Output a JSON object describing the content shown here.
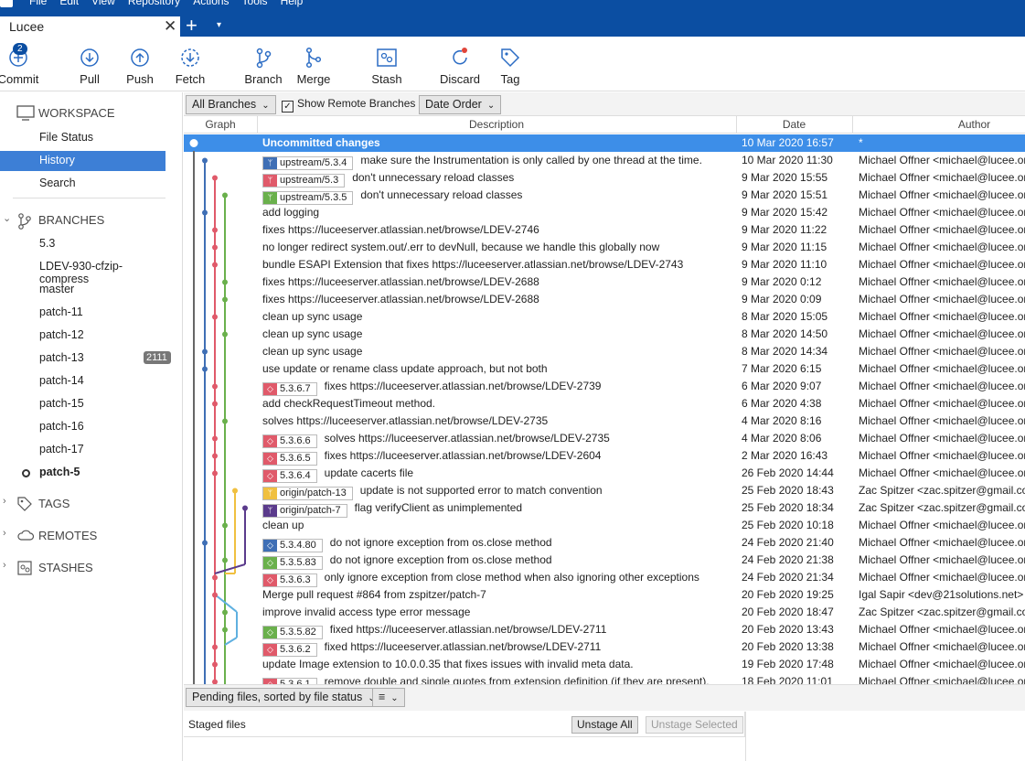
{
  "menu": {
    "items": [
      "File",
      "Edit",
      "View",
      "Repository",
      "Actions",
      "Tools",
      "Help"
    ]
  },
  "tab": {
    "title": "Lucee",
    "close": "✕",
    "new_tab": "+",
    "dropdown": "▾"
  },
  "toolbar": {
    "commit_badge": "2",
    "buttons": [
      {
        "label": "Commit",
        "icon": "commit-icon"
      },
      {
        "label": "Pull",
        "icon": "pull-icon"
      },
      {
        "label": "Push",
        "icon": "push-icon"
      },
      {
        "label": "Fetch",
        "icon": "fetch-icon"
      },
      {
        "label": "Branch",
        "icon": "branch-icon"
      },
      {
        "label": "Merge",
        "icon": "merge-icon"
      },
      {
        "label": "Stash",
        "icon": "stash-icon"
      },
      {
        "label": "Discard",
        "icon": "discard-icon"
      },
      {
        "label": "Tag",
        "icon": "tag-icon"
      }
    ]
  },
  "sidebar": {
    "workspace": {
      "title": "WORKSPACE",
      "items": [
        "File Status",
        "History",
        "Search"
      ],
      "active": "History"
    },
    "branches": {
      "title": "BRANCHES",
      "items": [
        "5.3",
        "LDEV-930-cfzip-compress",
        "master",
        "patch-11",
        "patch-12",
        "patch-13",
        "patch-14",
        "patch-15",
        "patch-16",
        "patch-17",
        "patch-5"
      ],
      "badge_patch13": "2111",
      "current": "patch-5"
    },
    "tags": {
      "title": "TAGS"
    },
    "remotes": {
      "title": "REMOTES"
    },
    "stashes": {
      "title": "STASHES"
    }
  },
  "filterbar": {
    "branches_select": "All Branches",
    "show_remote_label": "Show Remote Branches",
    "show_remote_checked": true,
    "order_select": "Date Order"
  },
  "columns": {
    "graph": "Graph",
    "description": "Description",
    "date": "Date",
    "author": "Author"
  },
  "colors": {
    "accent": "#0b4ea2",
    "selection": "#3d8ee8",
    "red": "#e05a6a",
    "green": "#6ab04c",
    "blue": "#3f6fb5",
    "yellow": "#f0c040",
    "purple": "#5b3b8c",
    "cyan": "#5fb0e0"
  },
  "commits": [
    {
      "desc": "Uncommitted changes",
      "date": "10 Mar 2020 16:57",
      "author": "*",
      "selected": true
    },
    {
      "tag": "upstream/5.3.4",
      "tag_kind": "branch",
      "tag_color": "#3f6fb5",
      "desc": "make sure the Instrumentation is only called by one thread at the time.",
      "date": "10 Mar 2020 11:30",
      "author": "Michael Offner <michael@lucee.org>"
    },
    {
      "tag": "upstream/5.3",
      "tag_kind": "branch",
      "tag_color": "#e05a6a",
      "desc": "don't unnecessary reload classes",
      "date": "9 Mar 2020 15:55",
      "author": "Michael Offner <michael@lucee.org>"
    },
    {
      "tag": "upstream/5.3.5",
      "tag_kind": "branch",
      "tag_color": "#6ab04c",
      "desc": "don't unnecessary reload classes",
      "date": "9 Mar 2020 15:51",
      "author": "Michael Offner <michael@lucee.org>"
    },
    {
      "desc": "add logging",
      "date": "9 Mar 2020 15:42",
      "author": "Michael Offner <michael@lucee.org>"
    },
    {
      "desc": "fixes https://luceeserver.atlassian.net/browse/LDEV-2746",
      "date": "9 Mar 2020 11:22",
      "author": "Michael Offner <michael@lucee.org>"
    },
    {
      "desc": "no longer redirect system.out/.err to devNull, because we handle this globally now",
      "date": "9 Mar 2020 11:15",
      "author": "Michael Offner <michael@lucee.org>"
    },
    {
      "desc": "bundle ESAPI Extension that fixes https://luceeserver.atlassian.net/browse/LDEV-2743",
      "date": "9 Mar 2020 11:10",
      "author": "Michael Offner <michael@lucee.org>"
    },
    {
      "desc": "fixes https://luceeserver.atlassian.net/browse/LDEV-2688",
      "date": "9 Mar 2020 0:12",
      "author": "Michael Offner <michael@lucee.org>"
    },
    {
      "desc": "fixes https://luceeserver.atlassian.net/browse/LDEV-2688",
      "date": "9 Mar 2020 0:09",
      "author": "Michael Offner <michael@lucee.org>"
    },
    {
      "desc": "clean up sync usage",
      "date": "8 Mar 2020 15:05",
      "author": "Michael Offner <michael@lucee.org>"
    },
    {
      "desc": "clean up sync usage",
      "date": "8 Mar 2020 14:50",
      "author": "Michael Offner <michael@lucee.org>"
    },
    {
      "desc": "clean up sync usage",
      "date": "8 Mar 2020 14:34",
      "author": "Michael Offner <michael@lucee.org>"
    },
    {
      "desc": "use update or rename class update approach, but not both",
      "date": "7 Mar 2020 6:15",
      "author": "Michael Offner <michael@lucee.org>"
    },
    {
      "tag": "5.3.6.7",
      "tag_kind": "tag",
      "tag_color": "#e05a6a",
      "desc": "fixes https://luceeserver.atlassian.net/browse/LDEV-2739",
      "date": "6 Mar 2020 9:07",
      "author": "Michael Offner <michael@lucee.org>"
    },
    {
      "desc": "add checkRequestTimeout method.",
      "date": "6 Mar 2020 4:38",
      "author": "Michael Offner <michael@lucee.org>"
    },
    {
      "desc": "solves https://luceeserver.atlassian.net/browse/LDEV-2735",
      "date": "4 Mar 2020 8:16",
      "author": "Michael Offner <michael@lucee.org>"
    },
    {
      "tag": "5.3.6.6",
      "tag_kind": "tag",
      "tag_color": "#e05a6a",
      "desc": "solves https://luceeserver.atlassian.net/browse/LDEV-2735",
      "date": "4 Mar 2020 8:06",
      "author": "Michael Offner <michael@lucee.org>"
    },
    {
      "tag": "5.3.6.5",
      "tag_kind": "tag",
      "tag_color": "#e05a6a",
      "desc": "fixes https://luceeserver.atlassian.net/browse/LDEV-2604",
      "date": "2 Mar 2020 16:43",
      "author": "Michael Offner <michael@lucee.org>"
    },
    {
      "tag": "5.3.6.4",
      "tag_kind": "tag",
      "tag_color": "#e05a6a",
      "desc": "update cacerts file",
      "date": "26 Feb 2020 14:44",
      "author": "Michael Offner <michael@lucee.org>"
    },
    {
      "tag": "origin/patch-13",
      "tag_kind": "branch",
      "tag_color": "#f0c040",
      "desc": "update is not supported error to match convention",
      "date": "25 Feb 2020 18:43",
      "author": "Zac Spitzer <zac.spitzer@gmail.com>"
    },
    {
      "tag": "origin/patch-7",
      "tag_kind": "branch",
      "tag_color": "#5b3b8c",
      "desc": "flag verifyClient as unimplemented",
      "date": "25 Feb 2020 18:34",
      "author": "Zac Spitzer <zac.spitzer@gmail.com>"
    },
    {
      "desc": "clean up",
      "date": "25 Feb 2020 10:18",
      "author": "Michael Offner <michael@lucee.org>"
    },
    {
      "tag": "5.3.4.80",
      "tag_kind": "tag",
      "tag_color": "#3f6fb5",
      "desc": "do not ignore exception from os.close method",
      "date": "24 Feb 2020 21:40",
      "author": "Michael Offner <michael@lucee.org>"
    },
    {
      "tag": "5.3.5.83",
      "tag_kind": "tag",
      "tag_color": "#6ab04c",
      "desc": "do not ignore exception from os.close method",
      "date": "24 Feb 2020 21:38",
      "author": "Michael Offner <michael@lucee.org>"
    },
    {
      "tag": "5.3.6.3",
      "tag_kind": "tag",
      "tag_color": "#e05a6a",
      "desc": "only ignore exception from close method when also ignoring other exceptions",
      "date": "24 Feb 2020 21:34",
      "author": "Michael Offner <michael@lucee.org>"
    },
    {
      "desc": "Merge pull request #864 from zspitzer/patch-7",
      "date": "20 Feb 2020 19:25",
      "author": "Igal Sapir <dev@21solutions.net>"
    },
    {
      "desc": "improve invalid access type error message",
      "date": "20 Feb 2020 18:47",
      "author": "Zac Spitzer <zac.spitzer@gmail.com>"
    },
    {
      "tag": "5.3.5.82",
      "tag_kind": "tag",
      "tag_color": "#6ab04c",
      "desc": "fixed https://luceeserver.atlassian.net/browse/LDEV-2711",
      "date": "20 Feb 2020 13:43",
      "author": "Michael Offner <michael@lucee.org>"
    },
    {
      "tag": "5.3.6.2",
      "tag_kind": "tag",
      "tag_color": "#e05a6a",
      "desc": "fixed https://luceeserver.atlassian.net/browse/LDEV-2711",
      "date": "20 Feb 2020 13:38",
      "author": "Michael Offner <michael@lucee.org>"
    },
    {
      "desc": "update Image extension to 10.0.0.35 that fixes issues with invalid meta data.",
      "date": "19 Feb 2020 17:48",
      "author": "Michael Offner <michael@lucee.org>"
    },
    {
      "tag": "5.3.6.1",
      "tag_kind": "tag",
      "tag_color": "#e05a6a",
      "desc": "remove double and single quotes from extension definition (if they are present).",
      "date": "18 Feb 2020 11:01",
      "author": "Michael Offner <michael@lucee.org>"
    }
  ],
  "bottom": {
    "pending_select": "Pending files, sorted by file status",
    "view_mode": "≡",
    "staged_label": "Staged files",
    "unstage_all": "Unstage All",
    "unstage_selected": "Unstage Selected"
  }
}
